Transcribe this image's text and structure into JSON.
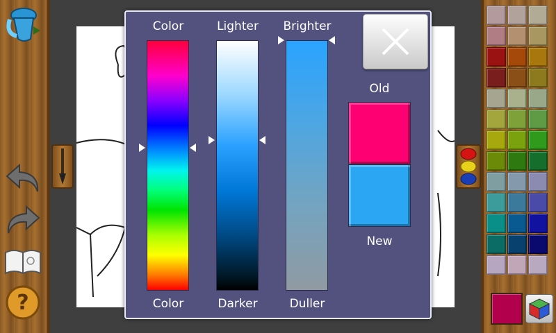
{
  "dialog": {
    "columns": {
      "hue": {
        "top_label": "Color",
        "bottom_label": "Color"
      },
      "lightness": {
        "top_label": "Lighter",
        "bottom_label": "Darker"
      },
      "saturation": {
        "top_label": "Brighter",
        "bottom_label": "Duller"
      }
    },
    "sliders": {
      "hue_level": 0.43,
      "lightness_level": 0.4,
      "saturation_level": 0.0
    },
    "compare": {
      "old_label": "Old",
      "new_label": "New",
      "old_color": "#ff0073",
      "new_color": "#2aa6f2"
    },
    "close_icon": "close-icon"
  },
  "toolbar": {
    "icons": [
      "paint-bucket-icon",
      "undo-icon",
      "redo-icon",
      "book-icon",
      "help-icon"
    ],
    "help_glyph": "?"
  },
  "side_tabs": {
    "brush_icon": "paintbrush-icon",
    "palette_icon": "palette-icon"
  },
  "palette": {
    "swatches": [
      "#b39a9c",
      "#b2a29c",
      "#b1aa95",
      "#b07d85",
      "#b39070",
      "#a89760",
      "#9b1212",
      "#a5490a",
      "#a8770d",
      "#7a1d1d",
      "#8a4f17",
      "#8d7a1f",
      "#a5a590",
      "#a8b08c",
      "#98a888",
      "#a3a63c",
      "#7ea13a",
      "#5f9a44",
      "#a6a80d",
      "#7aa20f",
      "#2f9a1b",
      "#6b8a07",
      "#2f7a10",
      "#166e2c",
      "#7e9ea1",
      "#8499ab",
      "#8b8ab0",
      "#3b9c9b",
      "#3c7a9c",
      "#4a4aa8",
      "#0a8e88",
      "#0a5a92",
      "#1212a0",
      "#0b6c66",
      "#08406e",
      "#0a0a6e",
      "#b6a6c0",
      "#c0a6b6",
      "#b8a8c0"
    ],
    "current_color": "#b3004d",
    "color_cube_icon": "color-cube-icon"
  },
  "colors": {
    "dialog_bg": "#53527f",
    "wood": "#9b672c"
  }
}
